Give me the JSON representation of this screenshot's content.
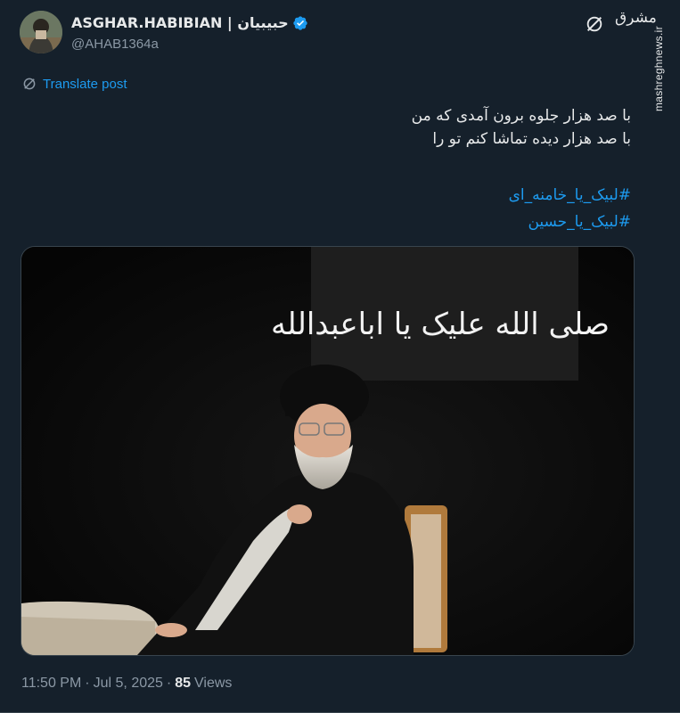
{
  "author": {
    "display_name": "ASGHAR.HABIBIAN | حبیبیان",
    "handle": "@AHAB1364a",
    "verified": true,
    "avatar_icon": "user-avatar"
  },
  "header_icons": {
    "grok": "grok-icon",
    "site_logo_text": "مشرق"
  },
  "watermark": "mashreghnews.ir",
  "translate_label": "Translate post",
  "post_lines": [
    "با صد هزار جلوه برون آمدی که من",
    "با صد هزار دیده تماشا کنم تو را"
  ],
  "hashtags": [
    "#لبیک_یا_خامنه_ای",
    "#لبیک_یا_حسین"
  ],
  "media": {
    "banner_text": "صلی الله علیک یا اباعبدالله"
  },
  "footer": {
    "time": "11:50 PM",
    "separator": "·",
    "date": "Jul 5, 2025",
    "views_count": "85",
    "views_label": "Views"
  },
  "colors": {
    "background": "#15202b",
    "accent": "#1d9bf0",
    "verified": "#1d9bf0",
    "muted": "#8b98a5"
  }
}
